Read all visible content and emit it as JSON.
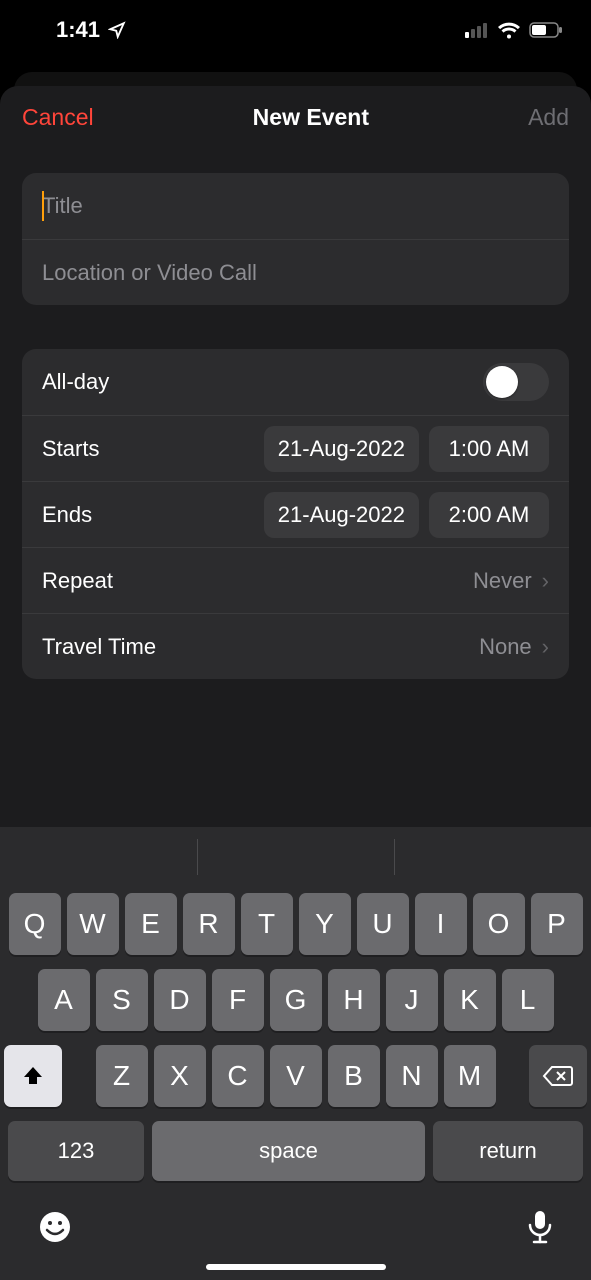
{
  "status": {
    "time": "1:41"
  },
  "nav": {
    "cancel": "Cancel",
    "title": "New Event",
    "add": "Add"
  },
  "form": {
    "title_placeholder": "Title",
    "location_placeholder": "Location or Video Call",
    "allday_label": "All-day",
    "starts_label": "Starts",
    "starts_date": "21-Aug-2022",
    "starts_time": "1:00 AM",
    "ends_label": "Ends",
    "ends_date": "21-Aug-2022",
    "ends_time": "2:00 AM",
    "repeat_label": "Repeat",
    "repeat_value": "Never",
    "travel_label": "Travel Time",
    "travel_value": "None"
  },
  "keyboard": {
    "row1": [
      "Q",
      "W",
      "E",
      "R",
      "T",
      "Y",
      "U",
      "I",
      "O",
      "P"
    ],
    "row2": [
      "A",
      "S",
      "D",
      "F",
      "G",
      "H",
      "J",
      "K",
      "L"
    ],
    "row3": [
      "Z",
      "X",
      "C",
      "V",
      "B",
      "N",
      "M"
    ],
    "numbers": "123",
    "space": "space",
    "return": "return"
  }
}
